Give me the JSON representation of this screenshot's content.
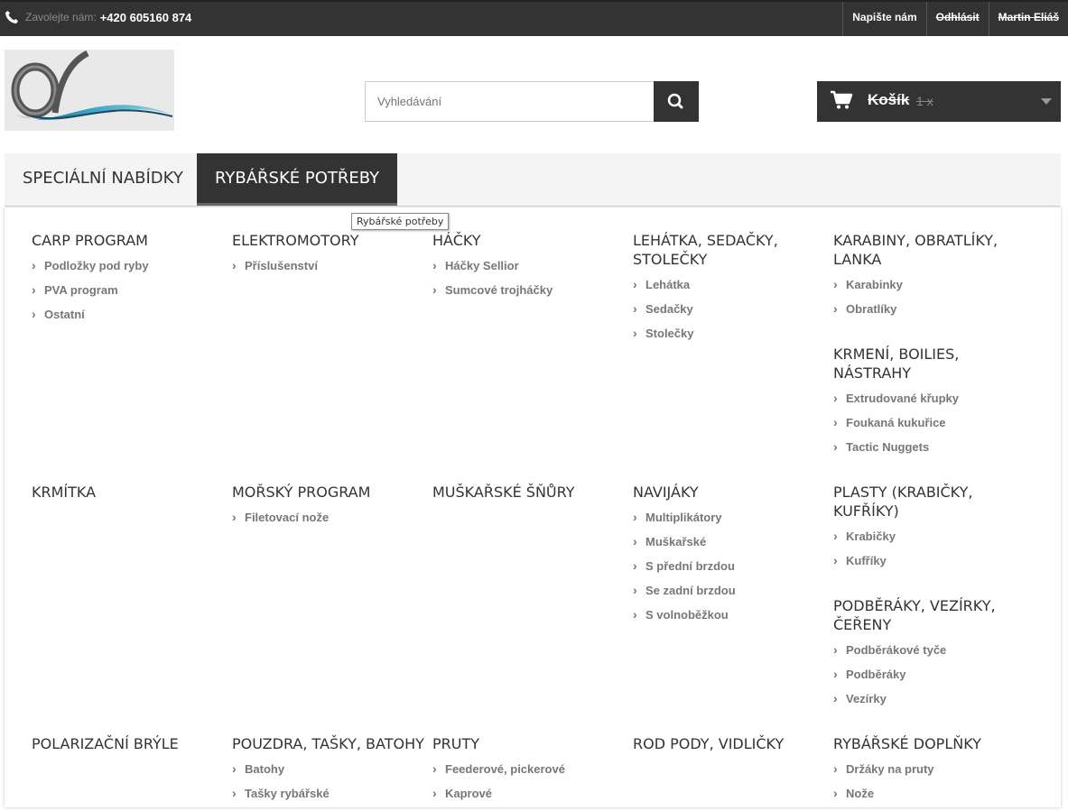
{
  "topbar": {
    "call_label": "Zavolejte nám:",
    "phone": "+420 605160 874",
    "links": [
      "Napište nám",
      "Odhlásit",
      "Martin Eliáš"
    ]
  },
  "search": {
    "placeholder": "Vyhledávání"
  },
  "cart": {
    "title": "Košík",
    "count": "1 x"
  },
  "nav": {
    "tabs": [
      "SPECIÁLNÍ NABÍDKY",
      "RYBÁŘSKÉ POTŘEBY"
    ]
  },
  "tooltip": "Rybářské potřeby",
  "categories": [
    {
      "title": "CARP PROGRAM",
      "items": [
        "Podložky pod ryby",
        "PVA program",
        "Ostatní"
      ]
    },
    {
      "title": "ELEKTROMOTORY",
      "items": [
        "Příslušenství"
      ]
    },
    {
      "title": "HÁČKY",
      "items": [
        "Háčky Sellior",
        "Sumcové trojháčky"
      ]
    },
    {
      "title": "LEHÁTKA, SEDAČKY, STOLEČKY",
      "items": [
        "Lehátka",
        "Sedačky",
        "Stolečky"
      ]
    },
    {
      "title": "KARABINY, OBRATLÍKY, LANKA",
      "items": [
        "Karabinky",
        "Obratlíky"
      ]
    },
    {
      "title": "KRMENÍ, BOILIES, NÁSTRAHY",
      "items": [
        "Extrudované křupky",
        "Foukaná kukuřice",
        "Tactic Nuggets"
      ]
    },
    {
      "title": "KRMÍTKA",
      "items": []
    },
    {
      "title": "MOŘSKÝ PROGRAM",
      "items": [
        "Filetovací nože"
      ]
    },
    {
      "title": "MUŠKAŘSKÉ ŠŇŮRY",
      "items": []
    },
    {
      "title": "NAVIJÁKY",
      "items": [
        "Multiplikátory",
        "Muškařské",
        "S přední brzdou",
        "Se zadní brzdou",
        "S volnoběžkou"
      ]
    },
    {
      "title": "PLASTY (KRABIČKY, KUFŘÍKY)",
      "items": [
        "Krabičky",
        "Kufříky"
      ]
    },
    {
      "title": "PODBĚRÁKY, VEZÍRKY, ČEŘENY",
      "items": [
        "Podběrákové tyče",
        "Podběráky",
        "Vezírky"
      ]
    },
    {
      "title": "POLARIZAČNÍ BRÝLE",
      "items": []
    },
    {
      "title": "POUZDRA, TAŠKY, BATOHY",
      "items": [
        "Batohy",
        "Tašky rybářské"
      ]
    },
    {
      "title": "PRUTY",
      "items": [
        "Feederové, pickerové",
        "Kaprové"
      ]
    },
    {
      "title": "ROD PODY, VIDLIČKY",
      "items": []
    },
    {
      "title": "RYBÁŘSKÉ DOPLŇKY",
      "items": [
        "Držáky na pruty",
        "Nože"
      ]
    }
  ]
}
